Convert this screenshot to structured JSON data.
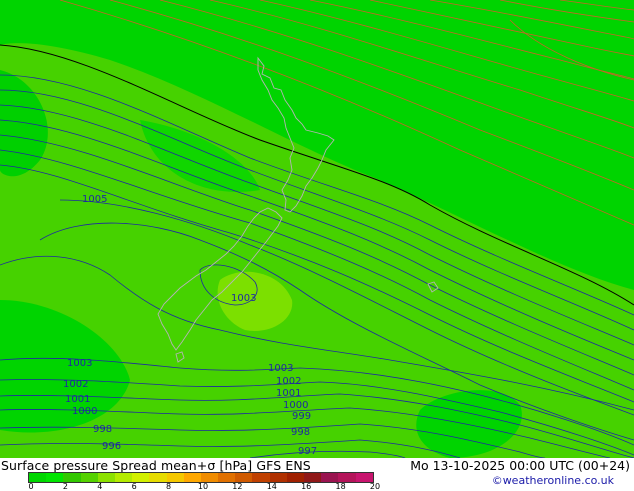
{
  "title": "Surface pressure Spread mean+σ [hPa] GFS ENS",
  "datetime": "Mo 13-10-2025 00:00 UTC (00+24)",
  "credit": "©weatheronline.co.uk",
  "colorbar": {
    "colors": [
      "#00d700",
      "#00e500",
      "#32c800",
      "#55d200",
      "#8ce100",
      "#b4eb00",
      "#d2f000",
      "#e6dc00",
      "#f5c800",
      "#ffa800",
      "#f08c00",
      "#e07000",
      "#d05a00",
      "#c04000",
      "#b03000",
      "#a02000",
      "#901818",
      "#9a1450",
      "#b4145a",
      "#c8146e"
    ],
    "tick_labels": [
      "0",
      "2",
      "4",
      "6",
      "8",
      "10",
      "12",
      "14",
      "16",
      "18",
      "20"
    ]
  },
  "isobar_labels": [
    "1005",
    "1003",
    "1003",
    "1002",
    "1001",
    "1000",
    "998",
    "996",
    "1003",
    "1002",
    "1001",
    "1000",
    "999",
    "998",
    "997"
  ],
  "colors": {
    "line_isobar": "#1e2aa0",
    "line_high": "#c86428",
    "coast": "#b4b4b4",
    "field_base": "#46d200"
  }
}
